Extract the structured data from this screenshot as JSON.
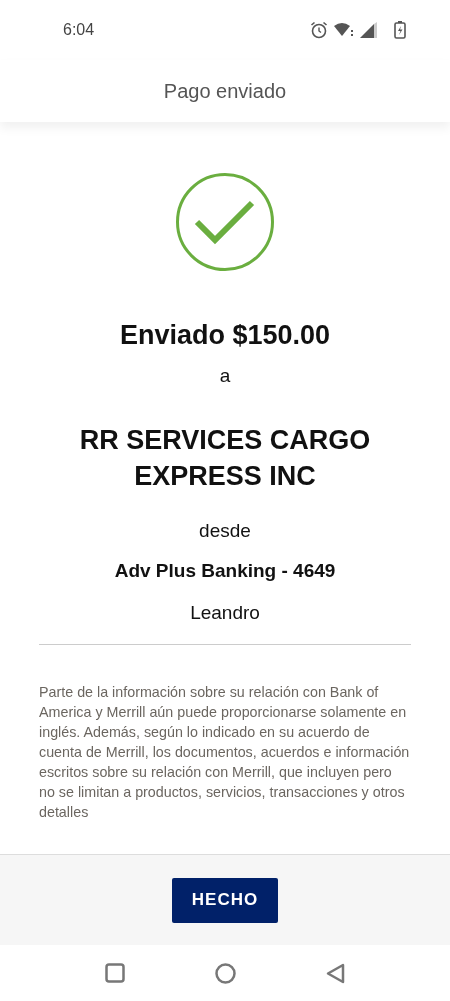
{
  "status_bar": {
    "time": "6:04"
  },
  "header": {
    "title": "Pago enviado"
  },
  "confirmation": {
    "amount_line": "Enviado $150.00",
    "to_word": "a",
    "recipient": "RR SERVICES CARGO EXPRESS INC",
    "from_word": "desde",
    "account": "Adv Plus Banking - 4649",
    "sender": "Leandro"
  },
  "disclaimer": "Parte de la información sobre su relación con Bank of America y Merrill aún puede proporcionarse solamente en inglés. Además, según lo indicado en su acuerdo de cuenta de Merrill, los documentos, acuerdos e información escritos sobre su relación con Merrill, que incluyen pero no se limitan a productos, servicios, transacciones y otros detalles",
  "buttons": [
    "HECHO"
  ]
}
